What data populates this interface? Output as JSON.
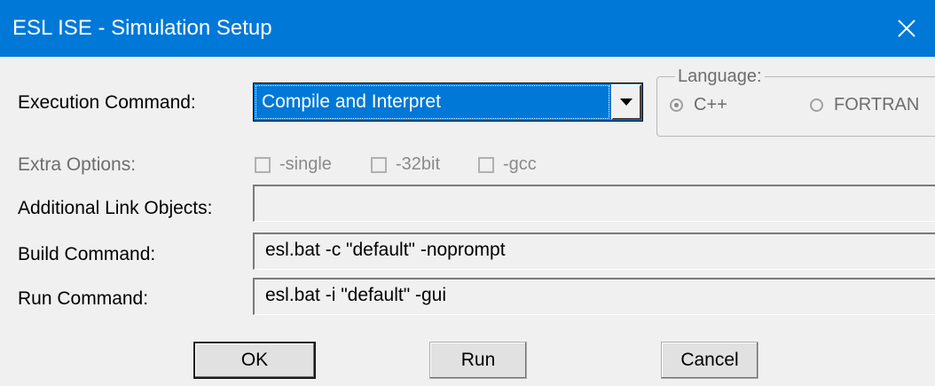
{
  "window": {
    "title": "ESL ISE - Simulation Setup",
    "close_glyph": "✕"
  },
  "execution": {
    "label": "Execution Command:",
    "selected": "Compile and Interpret"
  },
  "language": {
    "legend": "Language:",
    "options": [
      {
        "label": "C++",
        "selected": true
      },
      {
        "label": "FORTRAN",
        "selected": false
      }
    ]
  },
  "extra_options": {
    "label": "Extra Options:",
    "checkboxes": [
      {
        "label": "-single",
        "checked": false
      },
      {
        "label": "-32bit",
        "checked": false
      },
      {
        "label": "-gcc",
        "checked": false
      }
    ]
  },
  "link_objects": {
    "label": "Additional Link Objects:",
    "value": ""
  },
  "build": {
    "label": "Build Command:",
    "value": "esl.bat -c \"default\" -noprompt"
  },
  "run": {
    "label": "Run Command:",
    "value": "esl.bat -i \"default\" -gui"
  },
  "buttons": {
    "ok": "OK",
    "run": "Run",
    "cancel": "Cancel"
  },
  "colors": {
    "titlebar": "#0078d7",
    "selection": "#0078d7",
    "background": "#f0f0f0",
    "disabled_text": "#6d6d6d"
  }
}
